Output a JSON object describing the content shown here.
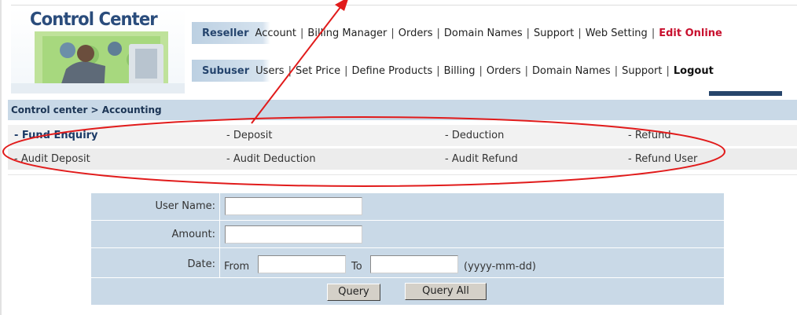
{
  "logo": {
    "title": "Control Center",
    "icon": "person-at-computer-illustration"
  },
  "nav_reseller": {
    "role": "Reseller",
    "links": [
      "Account",
      "Billing Manager",
      "Orders",
      "Domain Names",
      "Support",
      "Web Setting"
    ],
    "highlight": "Edit Online",
    "separator": "|"
  },
  "nav_subuser": {
    "role": "Subuser",
    "links": [
      "Users",
      "Set Price",
      "Define Products",
      "Billing",
      "Orders",
      "Domain Names",
      "Support"
    ],
    "highlight": "Logout",
    "separator": "|"
  },
  "breadcrumb": "Control center > Accounting",
  "menu": {
    "row1": [
      "- Fund Enquiry",
      "- Deposit",
      "- Deduction",
      "- Refund"
    ],
    "row2": [
      "- Audit Deposit",
      "- Audit Deduction",
      "- Audit Refund",
      "- Refund User"
    ]
  },
  "form": {
    "username_label": "User Name:",
    "username_value": "",
    "amount_label": "Amount:",
    "amount_value": "",
    "date_label": "Date:",
    "from_label": "From",
    "from_value": "",
    "to_label": "To",
    "to_value": "",
    "date_format": "(yyyy-mm-dd)",
    "query_button": "Query",
    "query_all_button": "Query All"
  },
  "colors": {
    "panel_bg": "#c9d9e7",
    "brand_dark": "#26456e",
    "highlight_red": "#c8102e",
    "annotation_red": "#e11b1b"
  }
}
